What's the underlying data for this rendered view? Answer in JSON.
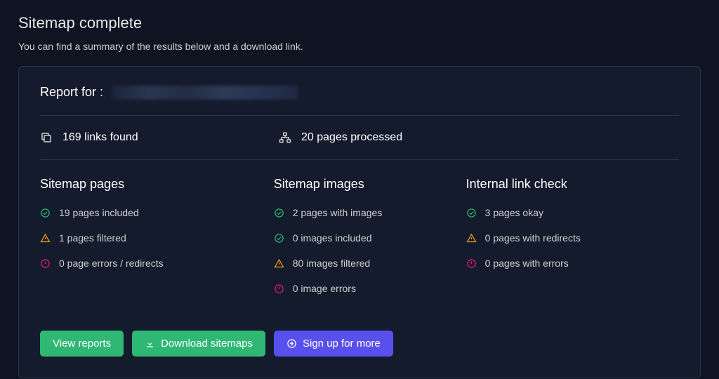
{
  "header": {
    "title": "Sitemap complete",
    "subtitle": "You can find a summary of the results below and a download link."
  },
  "report": {
    "label": "Report for :",
    "domain_redacted": true,
    "links_found": "169 links found",
    "pages_processed": "20 pages processed"
  },
  "columns": [
    {
      "title": "Sitemap pages",
      "items": [
        {
          "icon": "check",
          "text": "19 pages included"
        },
        {
          "icon": "warn",
          "text": "1 pages filtered"
        },
        {
          "icon": "error",
          "text": "0 page errors / redirects"
        }
      ]
    },
    {
      "title": "Sitemap images",
      "items": [
        {
          "icon": "check",
          "text": "2 pages with images"
        },
        {
          "icon": "check",
          "text": "0 images included"
        },
        {
          "icon": "warn",
          "text": "80 images filtered"
        },
        {
          "icon": "error",
          "text": "0 image errors"
        }
      ]
    },
    {
      "title": "Internal link check",
      "items": [
        {
          "icon": "check",
          "text": "3 pages okay"
        },
        {
          "icon": "warn",
          "text": "0 pages with redirects"
        },
        {
          "icon": "error",
          "text": "0 pages with errors"
        }
      ]
    }
  ],
  "buttons": {
    "view_reports": "View reports",
    "download": "Download sitemaps",
    "signup": "Sign up for more"
  },
  "colors": {
    "check": "#2eb873",
    "warn": "#f59e0b",
    "error": "#e11d6a"
  }
}
